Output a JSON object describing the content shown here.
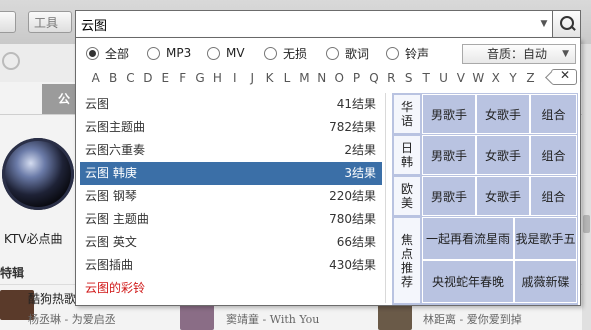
{
  "background": {
    "tools_label": "工具",
    "tab_label": "公",
    "mic_label": "KTV必点曲",
    "section_label": "特辑",
    "songs": [
      {
        "title": "酷狗热歌",
        "artist": "杨丞琳 - 为爱启丞"
      },
      {
        "title": "",
        "artist": "窦靖童 - With You"
      },
      {
        "title": "",
        "artist": "林距离 - 爱你爱到掉"
      }
    ]
  },
  "search": {
    "query": "云图",
    "dropdown_glyph": "▼"
  },
  "filters": {
    "options": [
      {
        "label": "全部",
        "checked": true
      },
      {
        "label": "MP3",
        "checked": false
      },
      {
        "label": "MV",
        "checked": false
      },
      {
        "label": "无损",
        "checked": false
      },
      {
        "label": "歌词",
        "checked": false
      },
      {
        "label": "铃声",
        "checked": false
      }
    ],
    "quality_label": "音质：自动",
    "quality_arrow": "▼"
  },
  "letters": [
    "A",
    "B",
    "C",
    "D",
    "E",
    "F",
    "G",
    "H",
    "I",
    "J",
    "K",
    "L",
    "M",
    "N",
    "O",
    "P",
    "Q",
    "R",
    "S",
    "T",
    "U",
    "V",
    "W",
    "X",
    "Y",
    "Z"
  ],
  "clear_label": "✕",
  "suggestions": [
    {
      "term": "云图",
      "count": "41结果"
    },
    {
      "term": "云图主题曲",
      "count": "782结果"
    },
    {
      "term": "云图六重奏",
      "count": "2结果"
    },
    {
      "term": "云图 韩庚",
      "count": "3结果",
      "selected": true
    },
    {
      "term": "云图 钢琴",
      "count": "220结果"
    },
    {
      "term": "云图 主题曲",
      "count": "780结果"
    },
    {
      "term": "云图 英文",
      "count": "66结果"
    },
    {
      "term": "云图插曲",
      "count": "430结果"
    },
    {
      "term": "云图的彩铃",
      "count": "",
      "ringtone": true
    }
  ],
  "recommend": {
    "categories": [
      "华语",
      "日韩",
      "欧美",
      "焦点推荐"
    ],
    "rows": [
      [
        "男歌手",
        "女歌手",
        "组合"
      ],
      [
        "男歌手",
        "女歌手",
        "组合"
      ],
      [
        "男歌手",
        "女歌手",
        "组合"
      ]
    ],
    "focus": [
      "一起再看流星雨",
      "我是歌手五",
      "央视蛇年春晚",
      "戚薇新碟"
    ]
  },
  "colors": {
    "selected_row": "#3b6fa7",
    "tile": "#b9c3e1",
    "ringtone": "#d01818"
  }
}
